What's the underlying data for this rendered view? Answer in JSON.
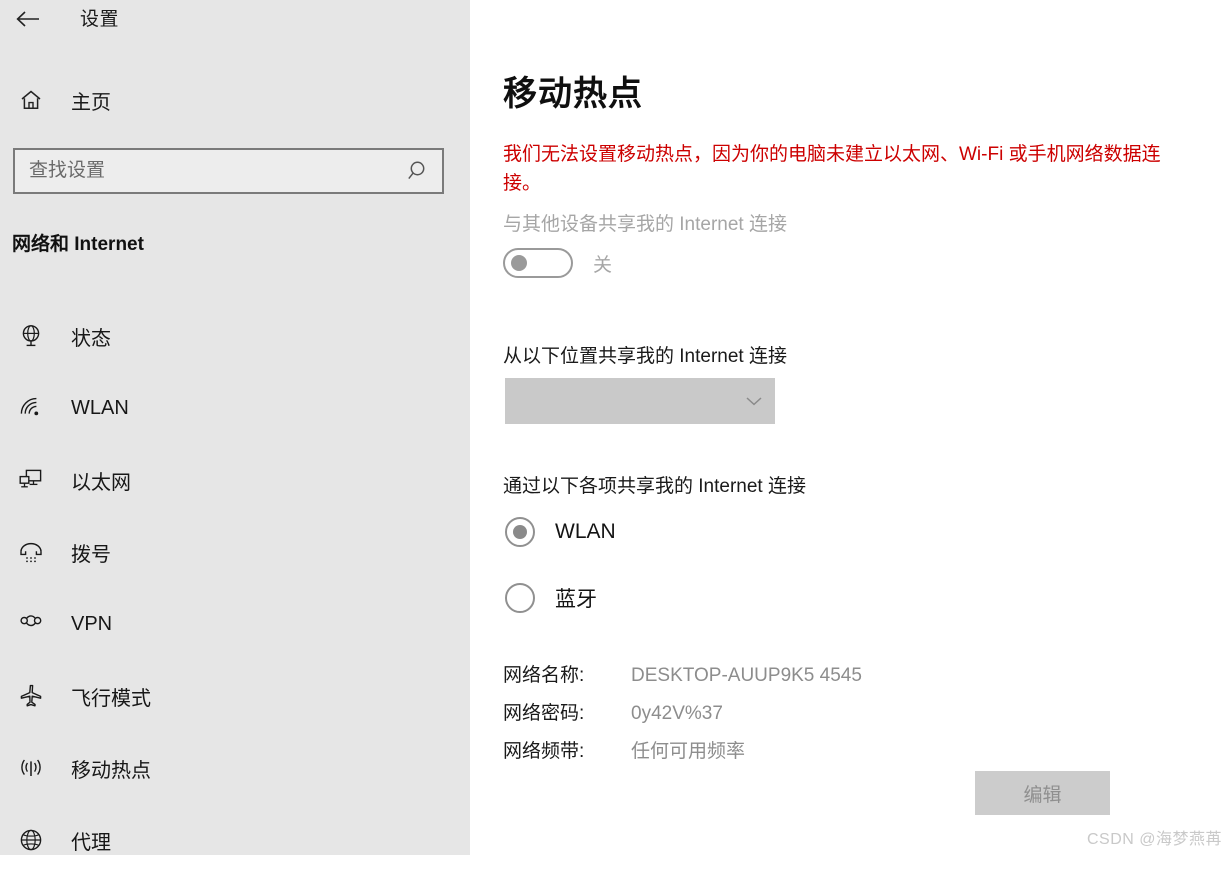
{
  "window": {
    "title": "设置",
    "back_icon": "back-arrow-icon"
  },
  "sidebar": {
    "home": {
      "label": "主页",
      "icon": "home-icon"
    },
    "search": {
      "placeholder": "查找设置",
      "value": "",
      "icon": "search-icon"
    },
    "category_title": "网络和 Internet",
    "items": [
      {
        "label": "状态",
        "icon": "network-status-icon",
        "selected": false
      },
      {
        "label": "WLAN",
        "icon": "wifi-icon",
        "selected": false
      },
      {
        "label": "以太网",
        "icon": "ethernet-icon",
        "selected": false
      },
      {
        "label": "拨号",
        "icon": "dialup-phone-icon",
        "selected": false
      },
      {
        "label": "VPN",
        "icon": "vpn-icon",
        "selected": false
      },
      {
        "label": "飞行模式",
        "icon": "airplane-icon",
        "selected": false
      },
      {
        "label": "移动热点",
        "icon": "hotspot-broadcast-icon",
        "selected": true
      },
      {
        "label": "代理",
        "icon": "globe-proxy-icon",
        "selected": false
      }
    ]
  },
  "main": {
    "page_title": "移动热点",
    "error_message": "我们无法设置移动热点，因为你的电脑未建立以太网、Wi-Fi 或手机网络数据连接。",
    "error_color": "#cc0000",
    "share_toggle": {
      "label": "与其他设备共享我的 Internet 连接",
      "state_text": "关",
      "checked": false
    },
    "share_from": {
      "label": "从以下位置共享我的 Internet 连接",
      "selected_value": "",
      "chevron_icon": "chevron-down-icon"
    },
    "share_over": {
      "label": "通过以下各项共享我的 Internet 连接",
      "options": [
        {
          "label": "WLAN",
          "checked": true
        },
        {
          "label": "蓝牙",
          "checked": false
        }
      ]
    },
    "network_info": [
      {
        "key": "网络名称:",
        "value": "DESKTOP-AUUP9K5 4545"
      },
      {
        "key": "网络密码:",
        "value": "0y42V%37"
      },
      {
        "key": "网络频带:",
        "value": "任何可用频率"
      }
    ],
    "edit_button": "编辑"
  },
  "watermark": "CSDN @海梦燕苒"
}
